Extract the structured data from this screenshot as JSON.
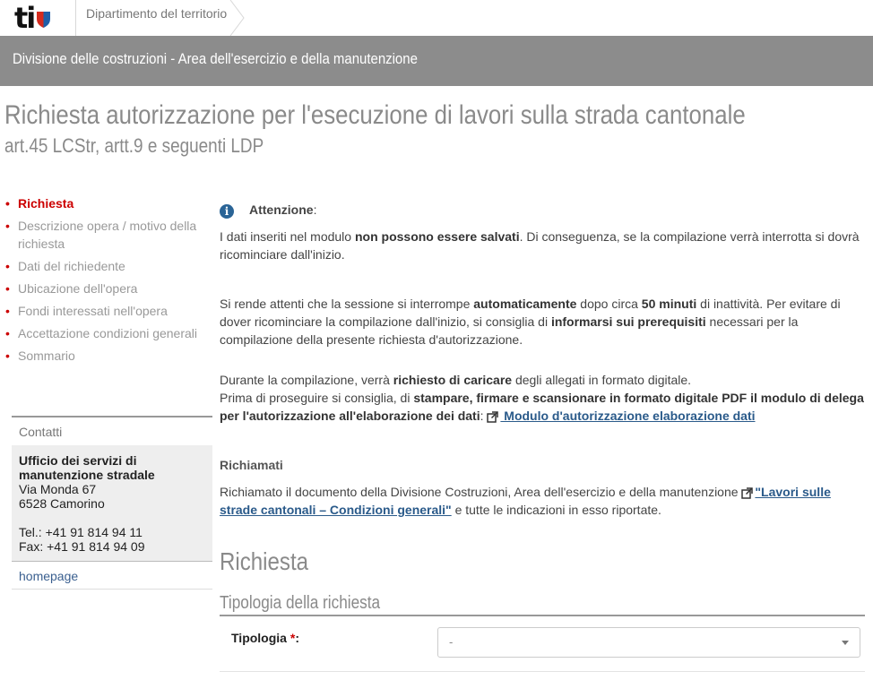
{
  "header": {
    "logo_text": "ti",
    "department": "Dipartimento del territorio",
    "division": "Divisione delle costruzioni - Area dell'esercizio e della manutenzione"
  },
  "page": {
    "title": "Richiesta autorizzazione per l'esecuzione di lavori sulla strada cantonale",
    "subtitle": "art.45 LCStr, artt.9 e seguenti LDP"
  },
  "nav": {
    "items": [
      {
        "label": "Richiesta"
      },
      {
        "label": "Descrizione opera / motivo della richiesta"
      },
      {
        "label": "Dati del richiedente"
      },
      {
        "label": "Ubicazione dell'opera"
      },
      {
        "label": "Fondi interessati nell'opera"
      },
      {
        "label": "Accettazione condizioni generali"
      },
      {
        "label": "Sommario"
      }
    ]
  },
  "contacts": {
    "heading": "Contatti",
    "office": "Ufficio dei servizi di manutenzione stradale",
    "street": "Via Monda 67",
    "city": "6528 Camorino",
    "tel": "Tel.: +41 91 814 94 11",
    "fax": "Fax: +41 91 814 94 09",
    "homepage": "homepage"
  },
  "notice": {
    "label": "Attenzione",
    "p1_a": "I dati inseriti nel modulo ",
    "p1_b": "non possono essere salvati",
    "p1_c": ". Di conseguenza, se la compilazione verrà interrotta si dovrà ricominciare dall'inizio.",
    "p2_a": "Si rende attenti che la sessione si interrompe ",
    "p2_b": "automaticamente",
    "p2_c": " dopo circa ",
    "p2_d": "50 minuti",
    "p2_e": " di inattività. Per evitare di dover ricominciare la compilazione dall'inizio, si consiglia di ",
    "p2_f": "informarsi sui prerequisiti",
    "p2_g": " necessari per la compilazione della presente richiesta d'autorizzazione.",
    "p3_a": "Durante la compilazione, verrà ",
    "p3_b": "richiesto di caricare",
    "p3_c": " degli allegati in formato digitale.",
    "p3_d": "Prima di proseguire si consiglia, di ",
    "p3_e": "stampare, firmare e scansionare in formato digitale PDF il modulo di delega per l'autorizzazione all'elaborazione dei dati",
    "p3_f": ": ",
    "p3_link": " Modulo d'autorizzazione elaborazione dati"
  },
  "recalled": {
    "heading": "Richiamati",
    "text_a": "Richiamato il documento della Divisione Costruzioni, Area dell'esercizio e della manutenzione ",
    "link": "\"Lavori sulle strade cantonali – Condizioni generali\"",
    "text_b": " e tutte le indicazioni in esso riportate."
  },
  "form": {
    "section_title": "Richiesta",
    "subsection_title": "Tipologia della richiesta",
    "tipologia_label": "Tipologia",
    "required_mark": "*",
    "colon": ":",
    "tipologia_value": "-"
  }
}
